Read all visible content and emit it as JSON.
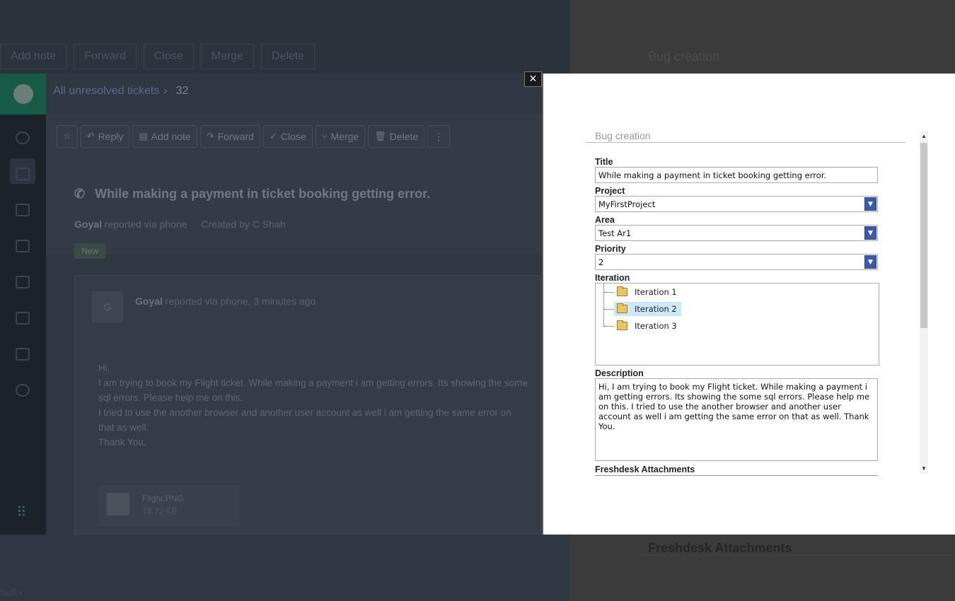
{
  "background": {
    "top_toolbar": [
      "Add note",
      "Forward",
      "Close",
      "Merge",
      "Delete"
    ],
    "breadcrumb": {
      "label": "All unresolved tickets",
      "count": "32"
    },
    "toolbar": {
      "reply": "Reply",
      "add_note": "Add note",
      "forward": "Forward",
      "close": "Close",
      "merge": "Merge",
      "delete": "Delete",
      "more": "⋮"
    },
    "ticket": {
      "subject": "While making a payment in ticket booking getting error.",
      "requester": "Goyal",
      "via": "reported via phone",
      "created_by": "Created by C Shah",
      "status": "New"
    },
    "message": {
      "avatar_letter": "G",
      "author": "Goyal",
      "meta": "reported via phone, 3 minutes ago",
      "lines": [
        "Hi,",
        "I am trying to book my Flight ticket. While making a payment i am getting errors. Its showing the some sql errors. Please help me on this.",
        "I tried to use the another browser and another user account as well i am getting the same error on that as well.",
        "Thank You."
      ],
      "attachment": {
        "name": "Flight.PNG",
        "size": "78.72 KB"
      }
    },
    "right_ghost": {
      "title": "Bug creation",
      "attachments": "Freshdesk Attachments"
    },
    "bottom_ghost": "Suffix"
  },
  "modal": {
    "close": "×",
    "title": "Bug creation",
    "labels": {
      "title": "Title",
      "project": "Project",
      "area": "Area",
      "priority": "Priority",
      "iteration": "Iteration",
      "description": "Description",
      "attachments": "Freshdesk Attachments"
    },
    "fields": {
      "title": "While making a payment in ticket booking getting error.",
      "project": "MyFirstProject",
      "area": "Test Ar1",
      "priority": "2",
      "description": "Hi,  I am trying to book my Flight ticket. While making a payment i am getting errors. Its showing the some sql errors. Please help me on this. I tried to use the another browser and another user account as well i am getting the same error on that as well.  Thank You."
    },
    "iterations": [
      "Iteration 1",
      "Iteration 2",
      "Iteration 3"
    ],
    "selected_iteration": "Iteration 2"
  }
}
